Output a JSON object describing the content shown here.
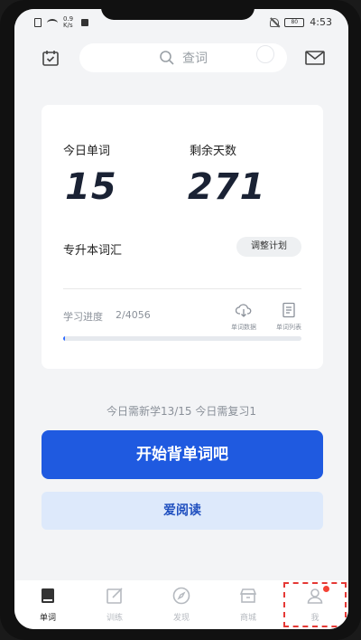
{
  "status_bar": {
    "speed": "0.9 K/s",
    "battery": "80",
    "time": "4:53"
  },
  "header": {
    "search_placeholder": "查词"
  },
  "card": {
    "today_words_label": "今日单词",
    "today_words_value": "15",
    "days_left_label": "剩余天数",
    "days_left_value": "271",
    "vocab_book": "专升本词汇",
    "adjust_plan": "调整计划",
    "progress_label": "学习进度",
    "progress_value": "2/4056",
    "progress_fraction": 0.0005,
    "tool_cloud_label": "单词数据",
    "tool_list_label": "单词列表"
  },
  "summary": "今日需新学13/15  今日需复习1",
  "buttons": {
    "start": "开始背单词吧",
    "read": "爱阅读"
  },
  "nav": [
    {
      "icon": "book-icon",
      "label": "单词"
    },
    {
      "icon": "edit-icon",
      "label": "训练"
    },
    {
      "icon": "compass-icon",
      "label": "发现"
    },
    {
      "icon": "store-icon",
      "label": "商城"
    },
    {
      "icon": "person-icon",
      "label": "我"
    }
  ],
  "colors": {
    "primary": "#1f5ae0",
    "secondary_bg": "#dde9fb",
    "badge": "#f44336"
  }
}
